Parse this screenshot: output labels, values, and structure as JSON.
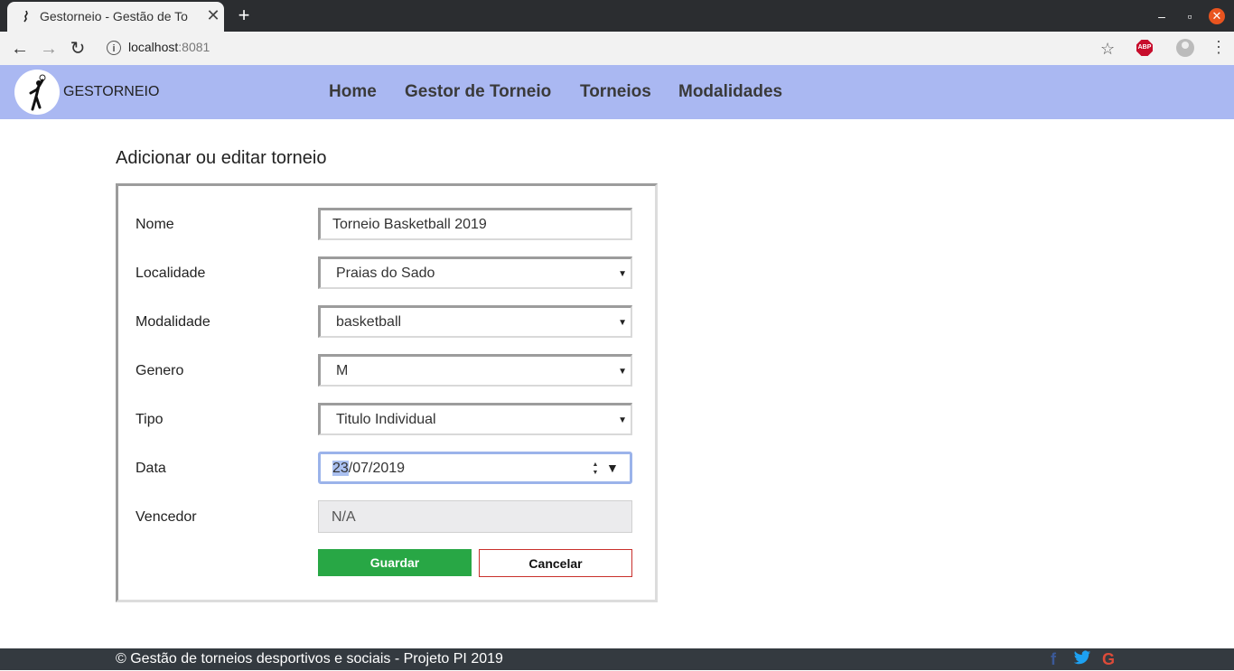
{
  "browser": {
    "tab_title": "Gestorneio - Gestão de To",
    "url_host": "localhost",
    "url_port": ":8081"
  },
  "site": {
    "brand": "GESTORNEIO",
    "nav": [
      "Home",
      "Gestor de Torneio",
      "Torneios",
      "Modalidades"
    ],
    "header_color": "#aab8f2"
  },
  "form": {
    "title": "Adicionar ou editar torneio",
    "fields": {
      "nome": {
        "label": "Nome",
        "value": "Torneio Basketball 2019"
      },
      "localidade": {
        "label": "Localidade",
        "value": "Praias do Sado"
      },
      "modalidade": {
        "label": "Modalidade",
        "value": "basketball"
      },
      "genero": {
        "label": "Genero",
        "value": "M"
      },
      "tipo": {
        "label": "Tipo",
        "value": "Titulo Individual"
      },
      "data": {
        "label": "Data",
        "day": "23",
        "rest": "/07/2019"
      },
      "vencedor": {
        "label": "Vencedor",
        "value": "N/A"
      }
    },
    "save_label": "Guardar",
    "cancel_label": "Cancelar"
  },
  "footer": {
    "text": "© Gestão de torneios desportivos e sociais - Projeto PI 2019",
    "social_icons": [
      "facebook-icon",
      "twitter-icon",
      "google-icon"
    ]
  }
}
